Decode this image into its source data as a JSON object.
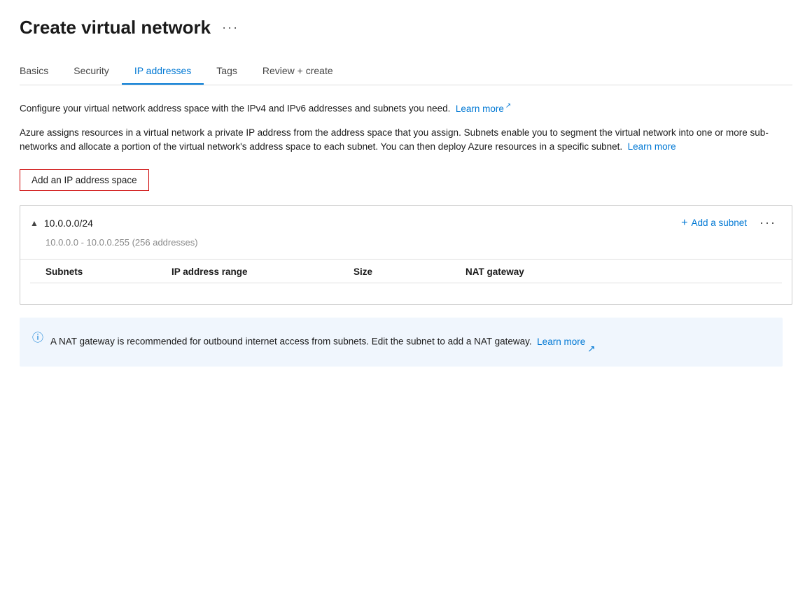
{
  "page": {
    "title": "Create virtual network",
    "ellipsis": "···"
  },
  "tabs": [
    {
      "id": "basics",
      "label": "Basics",
      "active": false
    },
    {
      "id": "security",
      "label": "Security",
      "active": false
    },
    {
      "id": "ip-addresses",
      "label": "IP addresses",
      "active": true
    },
    {
      "id": "tags",
      "label": "Tags",
      "active": false
    },
    {
      "id": "review-create",
      "label": "Review + create",
      "active": false
    }
  ],
  "description1": {
    "text": "Configure your virtual network address space with the IPv4 and IPv6 addresses and subnets you need. ",
    "learn_more": "Learn more",
    "ext": "↗"
  },
  "description2": {
    "text": "Azure assigns resources in a virtual network a private IP address from the address space that you assign. Subnets enable you to segment the virtual network into one or more sub-networks and allocate a portion of the virtual network's address space to each subnet. You can then deploy Azure resources in a specific subnet. ",
    "learn_more": "Learn more",
    "ext": ""
  },
  "add_ip_button": "Add an IP address space",
  "ip_space": {
    "cidr": "10.0.0.0/24",
    "range_text": "10.0.0.0 - 10.0.0.255 (256 addresses)",
    "add_subnet_label": "Add a subnet",
    "more_icon": "···",
    "columns": [
      "Subnets",
      "IP address range",
      "Size",
      "NAT gateway"
    ]
  },
  "nat_info": {
    "text": "A NAT gateway is recommended for outbound internet access from subnets. Edit the subnet to add a NAT gateway. ",
    "learn_more": "Learn more",
    "ext": "↗"
  }
}
